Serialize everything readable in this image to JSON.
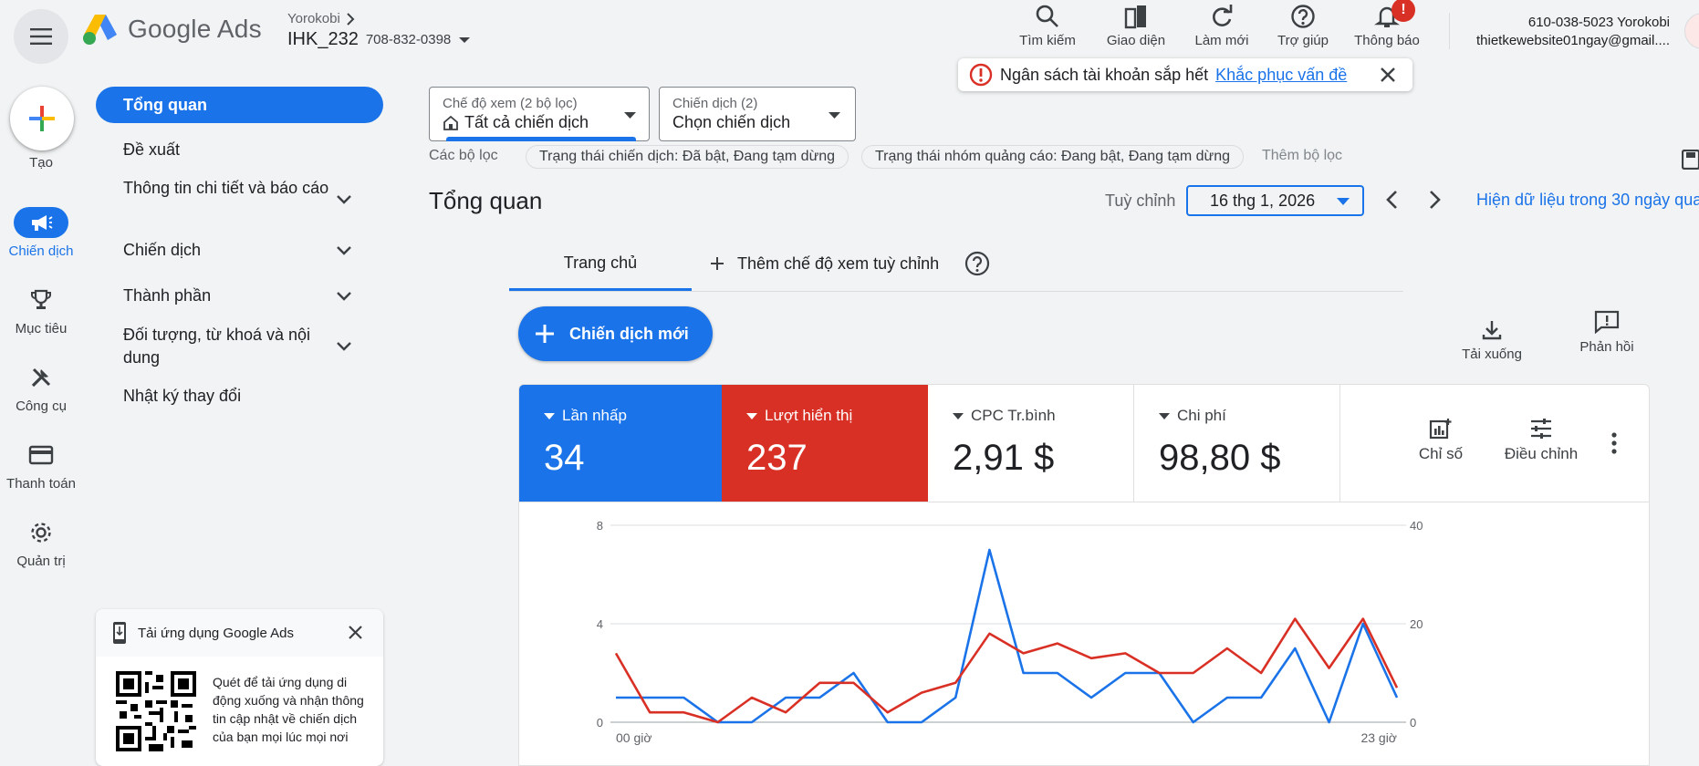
{
  "header": {
    "brand": "Google Ads",
    "account_parent": "Yorokobi",
    "account_name": "IHK_232",
    "account_id": "708-832-0398",
    "icons": [
      {
        "name": "search-icon",
        "label": "Tìm kiếm"
      },
      {
        "name": "appearance-icon",
        "label": "Giao diện"
      },
      {
        "name": "refresh-icon",
        "label": "Làm mới"
      },
      {
        "name": "help-icon",
        "label": "Trợ giúp"
      },
      {
        "name": "bell-icon",
        "label": "Thông báo"
      }
    ],
    "notification_badge": "!",
    "user_line1": "610-038-5023 Yorokobi",
    "user_line2": "thietkewebsite01ngay@gmail...."
  },
  "rail": {
    "create": "Tạo",
    "items": [
      {
        "label": "Chiến dịch",
        "icon": "megaphone-icon",
        "active": true
      },
      {
        "label": "Mục tiêu",
        "icon": "trophy-icon"
      },
      {
        "label": "Công cụ",
        "icon": "tools-icon"
      },
      {
        "label": "Thanh toán",
        "icon": "credit-card-icon"
      },
      {
        "label": "Quản trị",
        "icon": "gear-icon"
      }
    ]
  },
  "nav": {
    "active": "Tổng quan",
    "items": [
      "Đề xuất",
      "Thông tin chi tiết và báo cáo",
      "Chiến dịch",
      "Thành phần",
      "Đối tượng, từ khoá và nội dung",
      "Nhật ký thay đổi"
    ]
  },
  "qr_card": {
    "title": "Tải ứng dụng Google Ads",
    "text": "Quét để tải ứng dụng di động xuống và nhận thông tin cập nhật về chiến dịch của bạn mọi lúc mọi nơi"
  },
  "filters": {
    "view_label": "Chế độ xem (2 bộ lọc)",
    "view_value": "Tất cả chiến dịch",
    "campaign_label": "Chiến dịch (2)",
    "campaign_value": "Chọn chiến dịch",
    "chips_label": "Các bộ lọc",
    "chips": [
      "Trạng thái chiến dịch: Đã bật, Đang tạm dừng",
      "Trạng thái nhóm quảng cáo: Đang bật, Đang tạm dừng"
    ],
    "add_filter": "Thêm bộ lọc"
  },
  "alert": {
    "text": "Ngân sách tài khoản sắp hết",
    "link": "Khắc phục vấn đề"
  },
  "overview": {
    "title": "Tổng quan",
    "custom_label": "Tuỳ chỉnh",
    "date": "16 thg 1, 2026",
    "show_data": "Hiện dữ liệu trong 30 ngày qua",
    "tabs": [
      "Trang chủ",
      "Thêm chế độ xem tuỳ chỉnh"
    ],
    "new_campaign": "Chiến dịch mới",
    "download": "Tải xuống",
    "feedback": "Phản hồi"
  },
  "metrics": [
    {
      "label": "Lần nhấp",
      "value": "34",
      "color": "#1a73e8"
    },
    {
      "label": "Lượt hiển thị",
      "value": "237",
      "color": "#d93025"
    },
    {
      "label": "CPC Tr.bình",
      "value": "2,91 $"
    },
    {
      "label": "Chi phí",
      "value": "98,80 $"
    }
  ],
  "metric_tools": [
    "Chỉ số",
    "Điều chỉnh"
  ],
  "chart_data": {
    "type": "line",
    "x_start_label": "00 giờ",
    "x_end_label": "23 giờ",
    "x": [
      0,
      1,
      2,
      3,
      4,
      5,
      6,
      7,
      8,
      9,
      10,
      11,
      12,
      13,
      14,
      15,
      16,
      17,
      18,
      19,
      20,
      21,
      22,
      23
    ],
    "y_left_ticks": [
      0,
      4,
      8
    ],
    "y_right_ticks": [
      0,
      20,
      40
    ],
    "ylim_left": [
      0,
      8
    ],
    "ylim_right": [
      0,
      40
    ],
    "series": [
      {
        "axis": "left",
        "color": "#1a73e8",
        "values": [
          1,
          1,
          1,
          0,
          0,
          1,
          1,
          2,
          0,
          0,
          1,
          7,
          2,
          2,
          1,
          2,
          2,
          0,
          1,
          1,
          3,
          0,
          4,
          1
        ]
      },
      {
        "axis": "right",
        "color": "#d93025",
        "values": [
          14,
          2,
          2,
          0,
          5,
          2,
          8,
          8,
          2,
          6,
          8,
          18,
          14,
          16,
          13,
          14,
          10,
          10,
          15,
          10,
          21,
          11,
          21,
          7
        ]
      }
    ],
    "grid": true
  }
}
